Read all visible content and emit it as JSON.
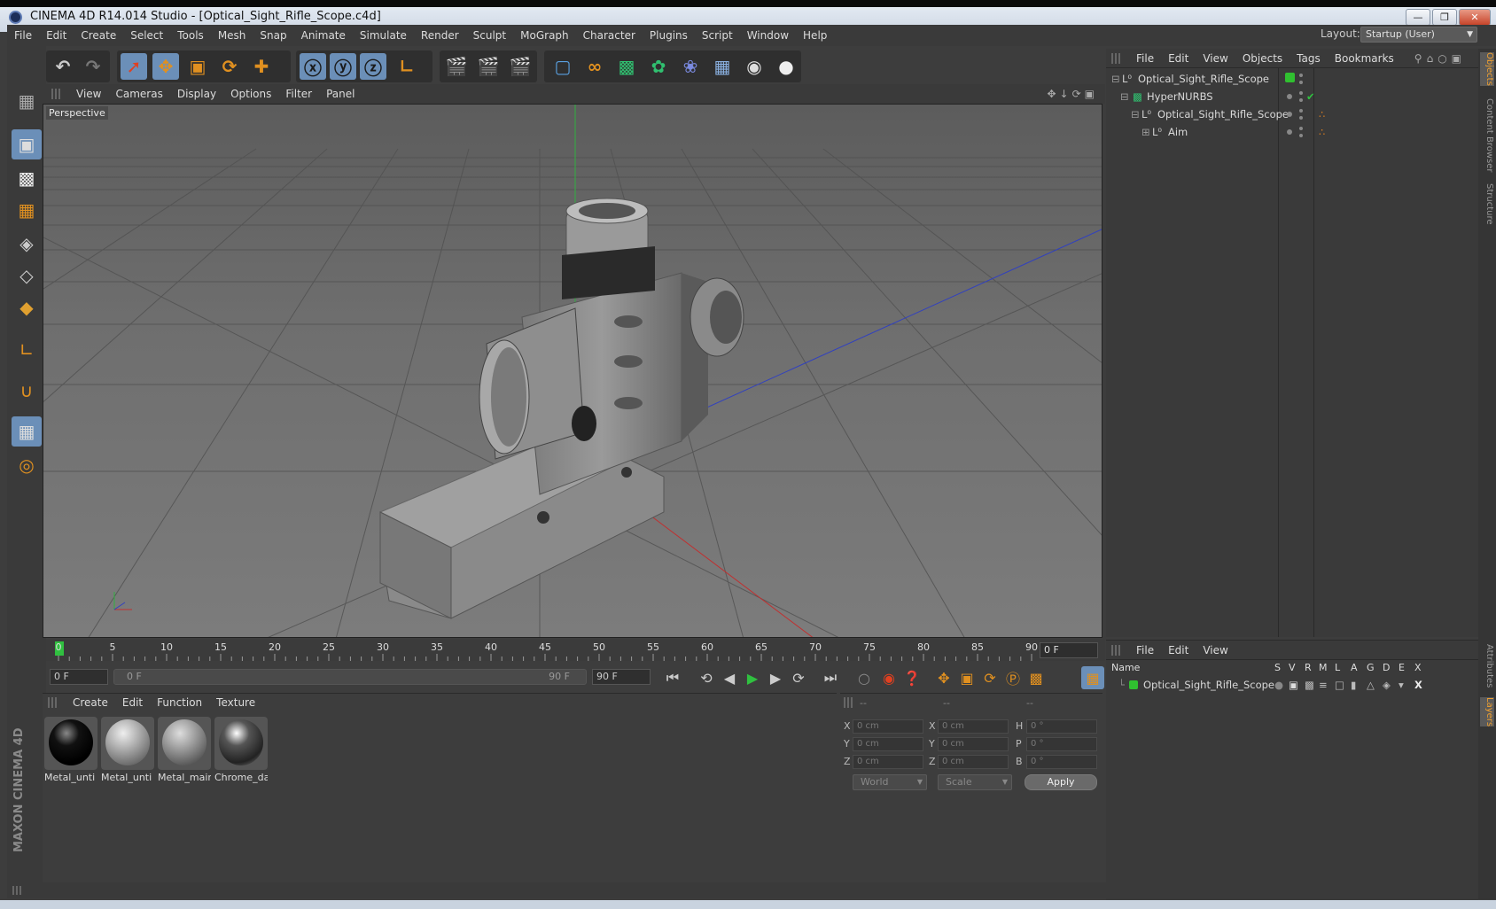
{
  "window": {
    "title": "CINEMA 4D R14.014 Studio - [Optical_Sight_Rifle_Scope.c4d]"
  },
  "menubar": [
    "File",
    "Edit",
    "Create",
    "Select",
    "Tools",
    "Mesh",
    "Snap",
    "Animate",
    "Simulate",
    "Render",
    "Sculpt",
    "MoGraph",
    "Character",
    "Plugins",
    "Script",
    "Window",
    "Help"
  ],
  "layout": {
    "label": "Layout:",
    "value": "Startup (User)"
  },
  "viewport": {
    "menu": [
      "View",
      "Cameras",
      "Display",
      "Options",
      "Filter",
      "Panel"
    ],
    "label": "Perspective"
  },
  "objects_panel": {
    "menu": [
      "File",
      "Edit",
      "View",
      "Objects",
      "Tags",
      "Bookmarks"
    ],
    "items": [
      {
        "name": "Optical_Sight_Rifle_Scope"
      },
      {
        "name": "HyperNURBS"
      },
      {
        "name": "Optical_Sight_Rifle_Scope"
      },
      {
        "name": "Aim"
      }
    ]
  },
  "timeline": {
    "ticks": [
      "0",
      "5",
      "10",
      "15",
      "20",
      "25",
      "30",
      "35",
      "40",
      "45",
      "50",
      "55",
      "60",
      "65",
      "70",
      "75",
      "80",
      "85",
      "90"
    ],
    "current_frame": "0 F",
    "start_field": "0 F",
    "range_start": "0 F",
    "range_end": "90 F",
    "end_field": "90 F"
  },
  "materials": {
    "menu": [
      "Create",
      "Edit",
      "Function",
      "Texture"
    ],
    "items": [
      {
        "name": "Metal_unti"
      },
      {
        "name": "Metal_unti"
      },
      {
        "name": "Metal_mair"
      },
      {
        "name": "Chrome_da"
      }
    ]
  },
  "coords": {
    "headers": [
      "--",
      "--",
      "--"
    ],
    "rows": [
      {
        "a": "X",
        "av": "0 cm",
        "b": "X",
        "bv": "0 cm",
        "c": "H",
        "cv": "0 °"
      },
      {
        "a": "Y",
        "av": "0 cm",
        "b": "Y",
        "bv": "0 cm",
        "c": "P",
        "cv": "0 °"
      },
      {
        "a": "Z",
        "av": "0 cm",
        "b": "Z",
        "bv": "0 cm",
        "c": "B",
        "cv": "0 °"
      }
    ],
    "mode1": "World",
    "mode2": "Scale",
    "apply": "Apply"
  },
  "layers_panel": {
    "menu": [
      "File",
      "Edit",
      "View"
    ],
    "header_name": "Name",
    "cols": [
      "S",
      "V",
      "R",
      "M",
      "L",
      "A",
      "G",
      "D",
      "E",
      "X"
    ],
    "layer": "Optical_Sight_Rifle_Scope"
  },
  "sidetabs": [
    "Objects",
    "Content Browser",
    "Structure",
    "Attributes",
    "Layers"
  ],
  "brand": "MAXON CINEMA 4D"
}
